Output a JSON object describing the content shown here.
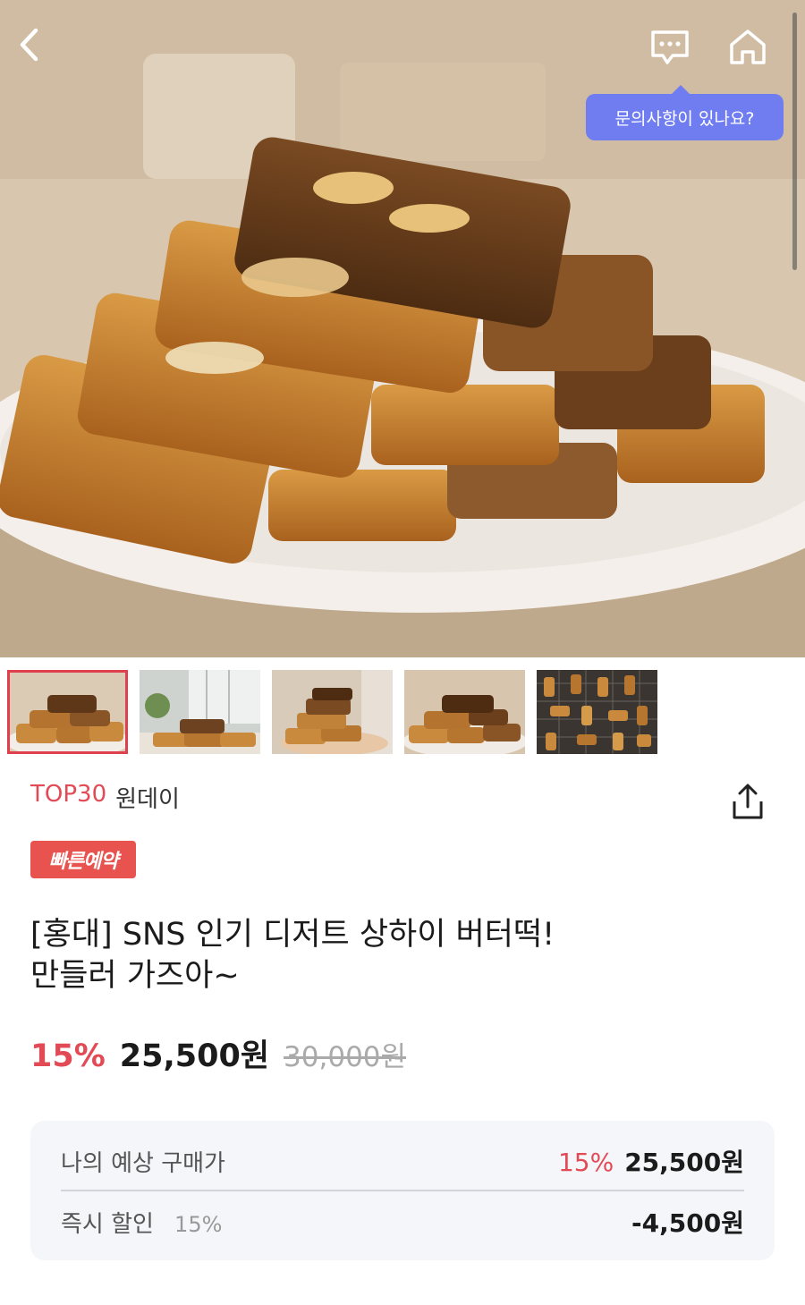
{
  "header": {
    "tooltip": "문의사항이 있나요?"
  },
  "icons": {
    "back": "chevron-left-icon",
    "chat": "chat-bubble-icon",
    "home": "home-icon",
    "share": "share-icon"
  },
  "gallery": {
    "selected_index": 0,
    "thumbnail_count": 5
  },
  "product": {
    "rank": "TOP30",
    "brand": "원데이",
    "badge": "빠른예약",
    "title_line1": "[홍대] SNS 인기 디저트 상하이 버터떡!",
    "title_line2": "만들러 가즈아~",
    "discount": "15%",
    "price": "25,500원",
    "original_price": "30,000원"
  },
  "summary": {
    "expected_label": "나의 예상 구매가",
    "expected_discount": "15%",
    "expected_price": "25,500원",
    "instant_label": "즉시 할인",
    "instant_rate": "15%",
    "instant_amount": "-4,500원"
  },
  "colors": {
    "accent_red": "#e24b55",
    "tooltip_blue": "#6f7df0",
    "badge_red": "#e8534f"
  }
}
